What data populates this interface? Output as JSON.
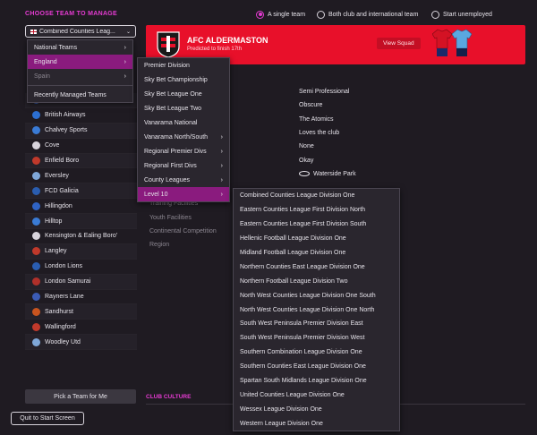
{
  "header": {
    "title": "CHOOSE TEAM TO MANAGE",
    "options": [
      {
        "label": "A single team",
        "selected": true
      },
      {
        "label": "Both club and international team",
        "selected": false
      },
      {
        "label": "Start unemployed",
        "selected": false
      }
    ]
  },
  "team_select": {
    "value": "Combined Counties Leag..."
  },
  "banner": {
    "club_name": "AFC ALDERMASTON",
    "subtitle": "Predicted to finish 17th",
    "view_squad": "View Squad",
    "color": "#e8102a"
  },
  "menu1": {
    "items": [
      {
        "label": "National Teams",
        "arrow": "›"
      },
      {
        "label": "England",
        "arrow": "›"
      },
      {
        "label": "Spain",
        "arrow": "›"
      },
      {
        "label": "Recently Managed Teams",
        "arrow": ""
      }
    ]
  },
  "menu2": {
    "items": [
      {
        "label": "Premier Division",
        "arrow": ""
      },
      {
        "label": "Sky Bet Championship",
        "arrow": ""
      },
      {
        "label": "Sky Bet League One",
        "arrow": ""
      },
      {
        "label": "Sky Bet League Two",
        "arrow": ""
      },
      {
        "label": "Vanarama National",
        "arrow": ""
      },
      {
        "label": "Vanarama North/South",
        "arrow": "›"
      },
      {
        "label": "Regional Premier Divs",
        "arrow": "›"
      },
      {
        "label": "Regional First Divs",
        "arrow": "›"
      },
      {
        "label": "County Leagues",
        "arrow": "›"
      },
      {
        "label": "Level 10",
        "arrow": "›"
      }
    ]
  },
  "menu3": {
    "items": [
      "Combined Counties League Division One",
      "Eastern Counties League First Division North",
      "Eastern Counties League First Division South",
      "Hellenic Football League Division One",
      "Midland Football League Division One",
      "Northern Counties East League Division One",
      "Northern Football League Division Two",
      "North West Counties League Division One South",
      "North West Counties League Division One North",
      "South West Peninsula Premier Division East",
      "South West Peninsula Premier Division West",
      "Southern Combination League Division One",
      "Southern Counties East League Division One",
      "Spartan South Midlands League Division One",
      "United Counties League Division One",
      "Wessex League Division One",
      "Western League Division One"
    ]
  },
  "clubs": [
    {
      "name": "Berks County",
      "color": "#3b5bb5"
    },
    {
      "name": "British Airways",
      "color": "#2c6fd1"
    },
    {
      "name": "Chalvey Sports",
      "color": "#3a7bd5"
    },
    {
      "name": "Cove",
      "color": "#d8d4dc"
    },
    {
      "name": "Enfield Boro",
      "color": "#c0392b"
    },
    {
      "name": "Eversley",
      "color": "#7fa7d8"
    },
    {
      "name": "FCD Galicia",
      "color": "#2a5db0"
    },
    {
      "name": "Hillingdon",
      "color": "#2f63c4"
    },
    {
      "name": "Hilltop",
      "color": "#3a7bd5"
    },
    {
      "name": "Kensington & Ealing Boro'",
      "color": "#d8d4dc"
    },
    {
      "name": "Langley",
      "color": "#c0392b"
    },
    {
      "name": "London Lions",
      "color": "#2a5db0"
    },
    {
      "name": "London Samurai",
      "color": "#b0302a"
    },
    {
      "name": "Rayners Lane",
      "color": "#3b5bb5"
    },
    {
      "name": "Sandhurst",
      "color": "#c8541f"
    },
    {
      "name": "Wallingford",
      "color": "#c0392b"
    },
    {
      "name": "Woodley Utd",
      "color": "#7fa7d8"
    }
  ],
  "details": {
    "values": [
      "Semi Professional",
      "Obscure",
      "The Atomics",
      "Loves the club",
      "None",
      "Okay",
      "Waterside Park"
    ],
    "labels": [
      "Training Facilities",
      "Youth Facilities",
      "Continental Competition",
      "Region"
    ]
  },
  "buttons": {
    "pick": "Pick a Team for Me",
    "quit": "Quit to Start Screen"
  },
  "club_culture": "CLUB CULTURE",
  "accent": "#e63bd3"
}
